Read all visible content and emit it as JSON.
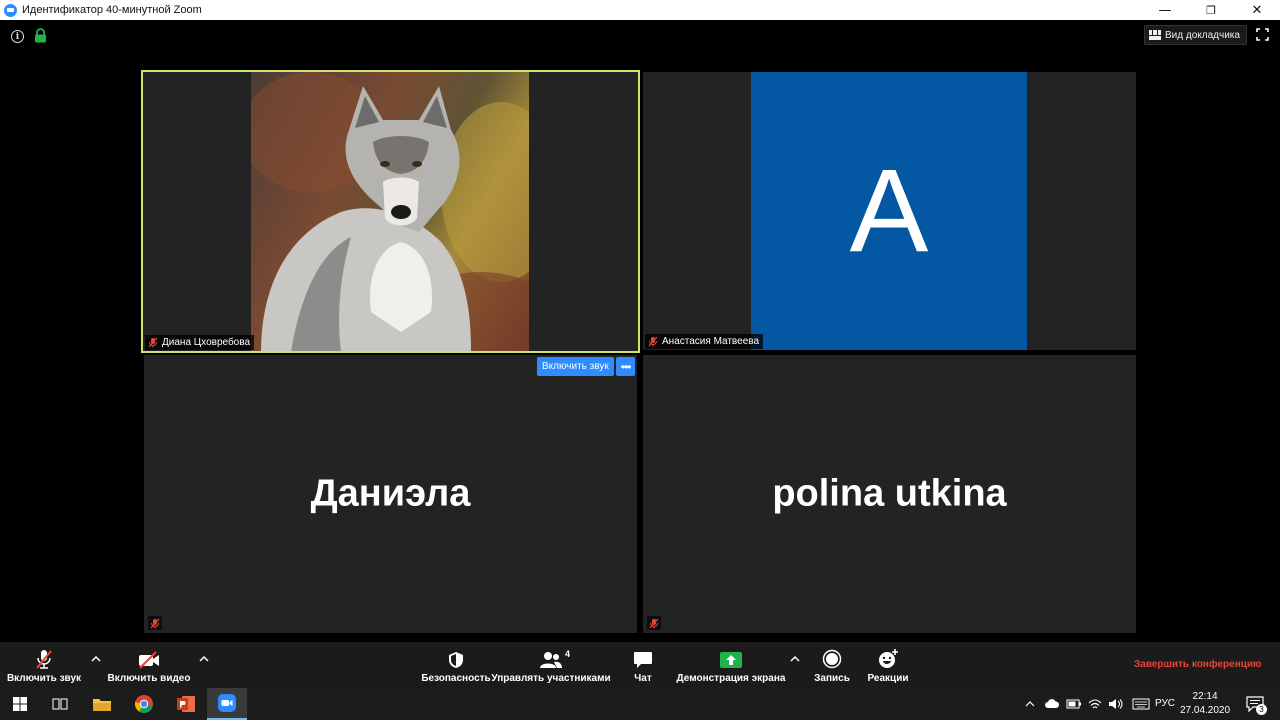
{
  "window": {
    "title": "Идентификатор 40-минутной Zoom",
    "minimize_glyph": "—",
    "restore_glyph": "❐",
    "close_glyph": "✕"
  },
  "topbar": {
    "info_glyph": "i",
    "speaker_view_label": "Вид докладчика"
  },
  "participants": [
    {
      "name": "Диана Цховребова",
      "video": "wolf-image",
      "active_speaker": true,
      "muted": true
    },
    {
      "name": "Анастасия Матвеева",
      "avatar_letter": "A",
      "avatar_color": "#0357a3",
      "muted": true
    },
    {
      "name": "Даниэла",
      "muted": true
    },
    {
      "name": "polina utkina",
      "muted": true
    }
  ],
  "tile_actions": {
    "unmute_label": "Включить звук",
    "more_label": "•••"
  },
  "toolbar": {
    "unmute_label": "Включить звук",
    "start_video_label": "Включить видео",
    "security_label": "Безопасность",
    "participants_label": "Управлять участниками",
    "participants_count": "4",
    "chat_label": "Чат",
    "share_label": "Демонстрация экрана",
    "record_label": "Запись",
    "reactions_label": "Реакции",
    "end_label": "Завершить конференцию"
  },
  "taskbar": {
    "language": "РУС",
    "time": "22:14",
    "date": "27.04.2020",
    "notifications_count": "3"
  },
  "colors": {
    "active_speaker_border": "#cfe36b",
    "accent_blue": "#2d8cff",
    "end_red": "#e8443a",
    "share_green": "#22b24c"
  }
}
